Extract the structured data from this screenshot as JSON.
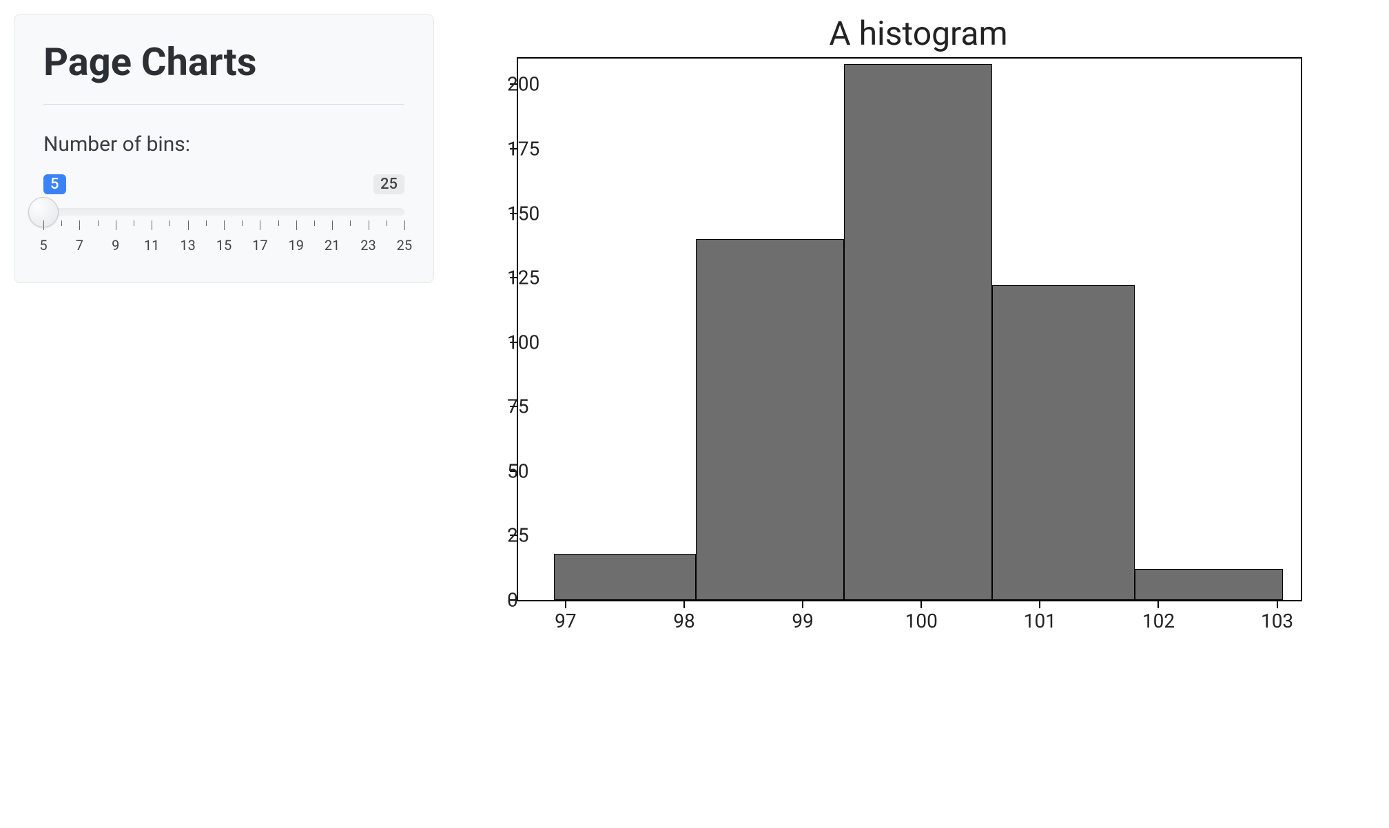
{
  "sidebar": {
    "title": "Page Charts",
    "slider_label": "Number of bins:",
    "slider_value": 5,
    "slider_min": 5,
    "slider_max": 25,
    "tick_labels": [
      5,
      7,
      9,
      11,
      13,
      15,
      17,
      19,
      21,
      23,
      25
    ]
  },
  "chart_data": {
    "type": "bar",
    "title": "A histogram",
    "xlabel": "",
    "ylabel": "",
    "xlim": [
      96.6,
      103.2
    ],
    "ylim": [
      0,
      210
    ],
    "xticks": [
      97,
      98,
      99,
      100,
      101,
      102,
      103
    ],
    "yticks": [
      0,
      25,
      50,
      75,
      100,
      125,
      150,
      175,
      200
    ],
    "bins": [
      {
        "x0": 96.9,
        "x1": 98.1,
        "count": 18
      },
      {
        "x0": 98.1,
        "x1": 99.35,
        "count": 140
      },
      {
        "x0": 99.35,
        "x1": 100.6,
        "count": 208
      },
      {
        "x0": 100.6,
        "x1": 101.8,
        "count": 122
      },
      {
        "x0": 101.8,
        "x1": 103.05,
        "count": 12
      }
    ]
  }
}
